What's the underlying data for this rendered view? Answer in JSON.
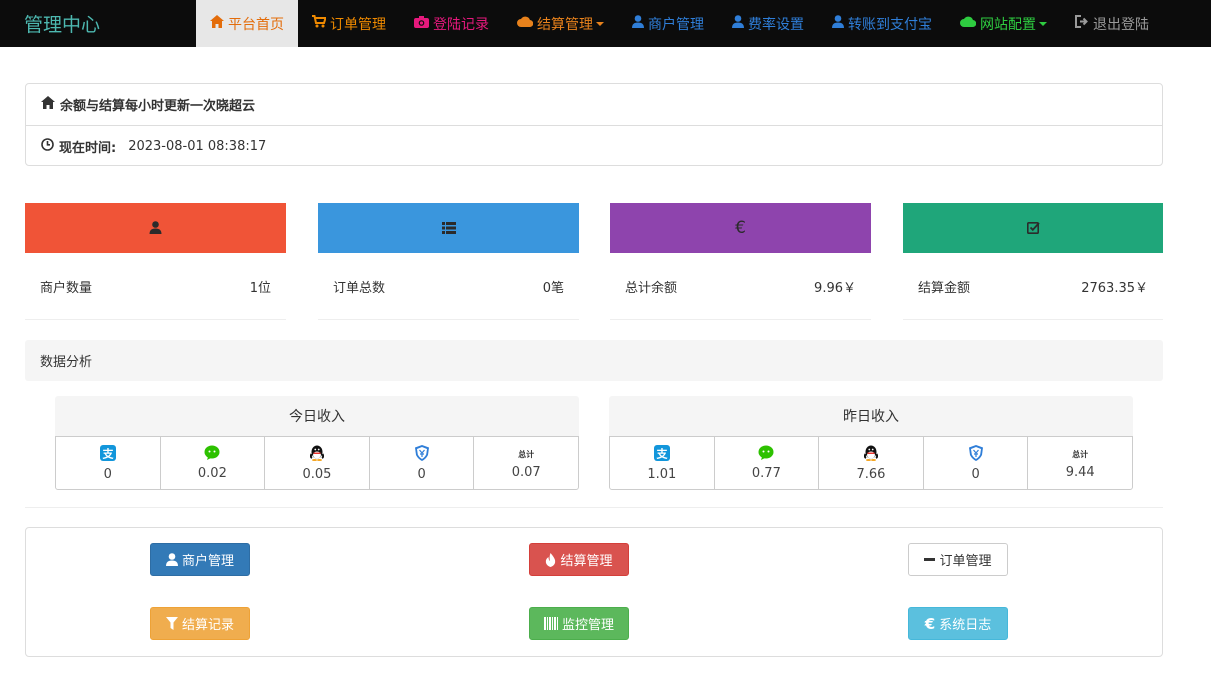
{
  "brand": "管理中心",
  "nav": [
    {
      "label": "平台首页",
      "icon": "home-icon",
      "color": "#e36c0a",
      "active": true
    },
    {
      "label": "订单管理",
      "icon": "cart-icon",
      "color": "#f08a00"
    },
    {
      "label": "登陆记录",
      "icon": "camera-icon",
      "color": "#e6197d"
    },
    {
      "label": "结算管理",
      "icon": "cloud-icon",
      "color": "#e8821c",
      "dropdown": true
    },
    {
      "label": "商户管理",
      "icon": "user-icon",
      "color": "#2f7ed8"
    },
    {
      "label": "费率设置",
      "icon": "user-icon",
      "color": "#2f7ed8"
    },
    {
      "label": "转账到支付宝",
      "icon": "user-icon",
      "color": "#2f7ed8"
    },
    {
      "label": "网站配置",
      "icon": "cloud-icon",
      "color": "#2ecc40",
      "dropdown": true
    },
    {
      "label": "退出登陆",
      "icon": "logout-icon",
      "color": "#9a9a9a"
    }
  ],
  "info": {
    "notice": "余额与结算每小时更新一次晓超云",
    "time_label": "现在时间:",
    "time_value": "2023-08-01 08:38:17"
  },
  "stats": [
    {
      "label": "商户数量",
      "value": "1位",
      "icon": "user-icon",
      "color": "#f05437"
    },
    {
      "label": "订单总数",
      "value": "0笔",
      "icon": "list-icon",
      "color": "#3a96dd"
    },
    {
      "label": "总计余额",
      "value": "9.96￥",
      "icon": "euro-icon",
      "color": "#8e44ad"
    },
    {
      "label": "结算金额",
      "value": "2763.35￥",
      "icon": "check-icon",
      "color": "#1fa67a"
    }
  ],
  "analysis_title": "数据分析",
  "today": {
    "title": "今日收入",
    "sum_label": "总计",
    "values": [
      "0",
      "0.02",
      "0.05",
      "0",
      "0.07"
    ]
  },
  "yesterday": {
    "title": "昨日收入",
    "sum_label": "总计",
    "values": [
      "1.01",
      "0.77",
      "7.66",
      "0",
      "9.44"
    ]
  },
  "payment_icons": [
    "alipay-icon",
    "wechat-icon",
    "qq-icon",
    "shield-icon"
  ],
  "buttons": {
    "merchant": "商户管理",
    "settle": "结算管理",
    "order": "订单管理",
    "settle_record": "结算记录",
    "monitor": "监控管理",
    "syslog": "系统日志"
  }
}
